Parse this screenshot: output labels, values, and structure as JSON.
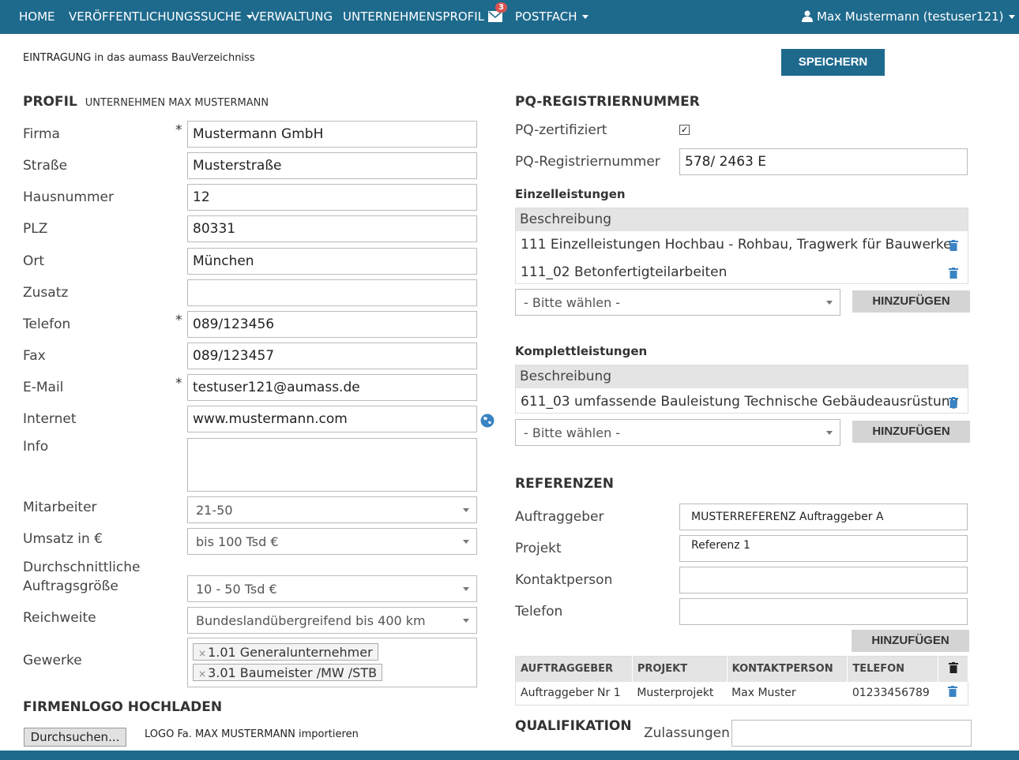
{
  "nav": {
    "home": "HOME",
    "search": "VERÖFFENTLICHUNGSSUCHE",
    "admin": "VERWALTUNG",
    "profile": "UNTERNEHMENSPROFIL",
    "mail_badge": "3",
    "inbox": "POSTFACH",
    "user": "Max Mustermann (testuser121)"
  },
  "header": {
    "note": "EINTRAGUNG in das aumass BauVerzeichniss",
    "save": "SPEICHERN"
  },
  "profile": {
    "title": "PROFIL",
    "subtitle": "UNTERNEHMEN MAX MUSTERMANN",
    "required_mark": "*",
    "fields": {
      "firma": {
        "label": "Firma",
        "value": "Mustermann GmbH"
      },
      "strasse": {
        "label": "Straße",
        "value": "Musterstraße"
      },
      "hausnummer": {
        "label": "Hausnummer",
        "value": "12"
      },
      "plz": {
        "label": "PLZ",
        "value": "80331"
      },
      "ort": {
        "label": "Ort",
        "value": "München"
      },
      "zusatz": {
        "label": "Zusatz",
        "value": ""
      },
      "telefon": {
        "label": "Telefon",
        "value": "089/123456"
      },
      "fax": {
        "label": "Fax",
        "value": "089/123457"
      },
      "email": {
        "label": "E-Mail",
        "value": "testuser121@aumass.de"
      },
      "internet": {
        "label": "Internet",
        "value": "www.mustermann.com"
      },
      "info": {
        "label": "Info",
        "value": ""
      }
    },
    "mitarbeiter": {
      "label": "Mitarbeiter",
      "value": "21-50"
    },
    "umsatz": {
      "label": "Umsatz in €",
      "value": "bis 100 Tsd €"
    },
    "auftrag": {
      "label_line1": "Durchschnittliche",
      "label_line2": "Auftragsgröße",
      "value": "10 - 50 Tsd €"
    },
    "reichweite": {
      "label": "Reichweite",
      "value": "Bundeslandübergreifend bis 400 km"
    },
    "gewerke": {
      "label": "Gewerke",
      "tags": [
        "1.01 Generalunternehmer",
        "3.01 Baumeister /MW /STB"
      ],
      "remove": "×"
    }
  },
  "logo": {
    "title": "FIRMENLOGO HOCHLADEN",
    "browse": "Durchsuchen...",
    "note": "LOGO Fa. MAX MUSTERMANN importieren"
  },
  "pq": {
    "title": "PQ-REGISTRIERNUMMER",
    "cert_label": "PQ-zertifiziert",
    "cert_check": "✓",
    "reg_label": "PQ-Registriernummer",
    "reg_value": "578/ 2463 E"
  },
  "einzel": {
    "title": "Einzelleistungen",
    "head": "Beschreibung",
    "rows": [
      "111 Einzelleistungen Hochbau - Rohbau, Tragwerk für Bauwerke",
      "111_02 Betonfertigteilarbeiten"
    ],
    "select": "- Bitte wählen -",
    "add": "HINZUFÜGEN"
  },
  "komplett": {
    "title": "Komplettleistungen",
    "head": "Beschreibung",
    "rows": [
      "611_03 umfassende Bauleistung Technische Gebäudeausrüstung"
    ],
    "select": "- Bitte wählen -",
    "add": "HINZUFÜGEN"
  },
  "referenzen": {
    "title": "REFERENZEN",
    "auftraggeber": {
      "label": "Auftraggeber",
      "value": "MUSTERREFERENZ Auftraggeber A"
    },
    "projekt": {
      "label": "Projekt",
      "value": "Referenz 1"
    },
    "kontakt": {
      "label": "Kontaktperson",
      "value": ""
    },
    "telefon": {
      "label": "Telefon",
      "value": ""
    },
    "add": "HINZUFÜGEN",
    "table": {
      "headers": [
        "AUFTRAGGEBER",
        "PROJEKT",
        "KONTAKTPERSON",
        "TELEFON"
      ],
      "rows": [
        [
          "Auftraggeber Nr 1",
          "Musterprojekt",
          "Max Muster",
          "01233456789"
        ]
      ]
    }
  },
  "qualifikation": {
    "title": "QUALIFIKATION",
    "zulassungen_label": "Zulassungen",
    "zulassungen_value": ""
  }
}
